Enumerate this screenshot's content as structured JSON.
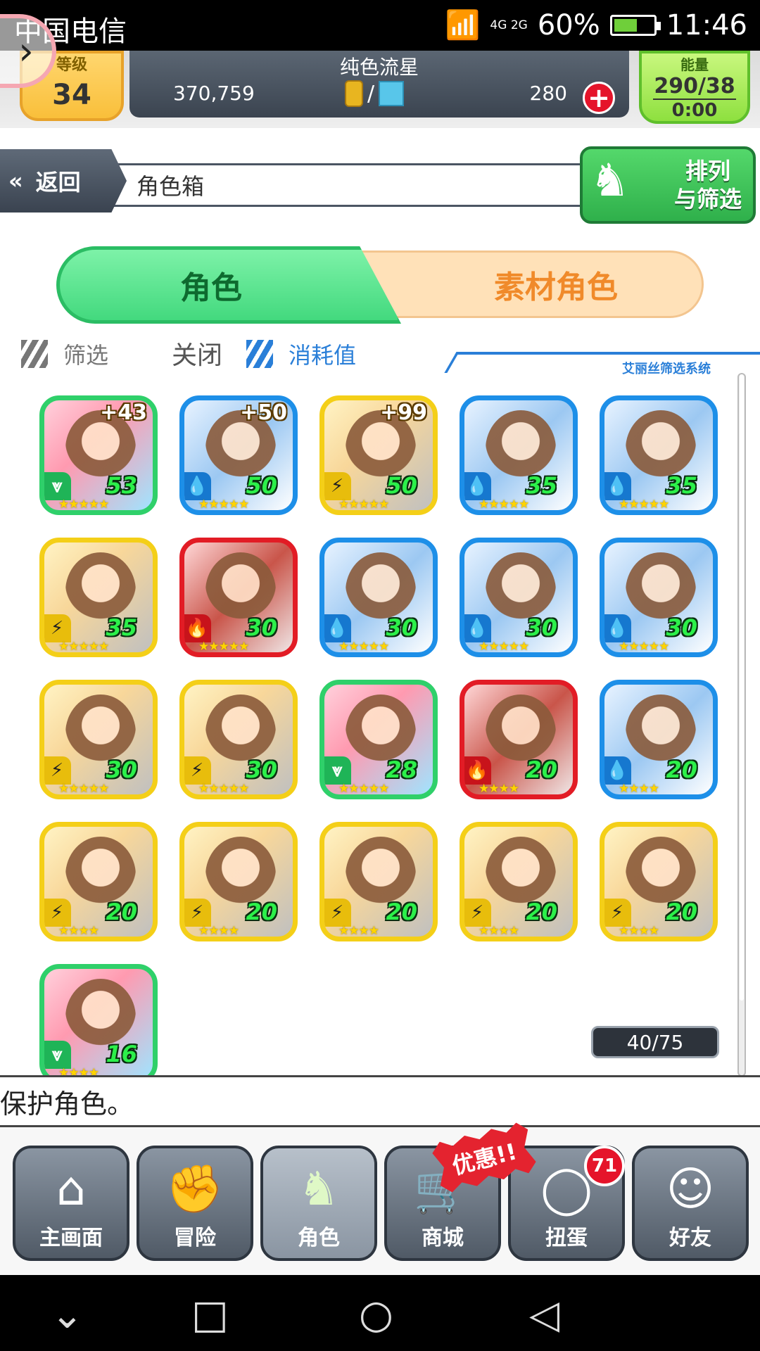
{
  "status_bar": {
    "carrier": "中国电信",
    "network": "4G 2G",
    "battery": "60%",
    "battery_level": 0.6,
    "time": "11:46"
  },
  "header": {
    "level_label": "等级",
    "level_value": "34",
    "player_name": "纯色流星",
    "coins": "370,759",
    "currency_sep": "/",
    "gems": "280",
    "stamina_label": "能量",
    "stamina": "290/38",
    "stamina_timer": "0:00"
  },
  "nav": {
    "back_label": "返回",
    "page_title": "角色箱",
    "sort_label_1": "排列",
    "sort_label_2": "与筛选"
  },
  "tabs": {
    "characters": "角色",
    "materials": "素材角色"
  },
  "filter": {
    "filter_label": "筛选",
    "filter_state": "关闭",
    "consumption_label": "消耗值",
    "system_label": "艾丽丝筛选系统"
  },
  "characters": [
    {
      "element": "wind",
      "level": "53",
      "plus": "+43",
      "stars": "★★★★★"
    },
    {
      "element": "water",
      "level": "50",
      "plus": "+50",
      "stars": "★★★★★"
    },
    {
      "element": "thunder",
      "level": "50",
      "plus": "+99",
      "stars": "★★★★★"
    },
    {
      "element": "water",
      "level": "35",
      "plus": "",
      "stars": "★★★★★"
    },
    {
      "element": "water",
      "level": "35",
      "plus": "",
      "stars": "★★★★★"
    },
    {
      "element": "thunder",
      "level": "35",
      "plus": "",
      "stars": "★★★★★"
    },
    {
      "element": "fire",
      "level": "30",
      "plus": "",
      "stars": "★★★★★"
    },
    {
      "element": "water",
      "level": "30",
      "plus": "",
      "stars": "★★★★★"
    },
    {
      "element": "water",
      "level": "30",
      "plus": "",
      "stars": "★★★★★"
    },
    {
      "element": "water",
      "level": "30",
      "plus": "",
      "stars": "★★★★★"
    },
    {
      "element": "thunder",
      "level": "30",
      "plus": "",
      "stars": "★★★★★"
    },
    {
      "element": "thunder",
      "level": "30",
      "plus": "",
      "stars": "★★★★★"
    },
    {
      "element": "wind",
      "level": "28",
      "plus": "",
      "stars": "★★★★★"
    },
    {
      "element": "fire",
      "level": "20",
      "plus": "",
      "stars": "★★★★"
    },
    {
      "element": "water",
      "level": "20",
      "plus": "",
      "stars": "★★★★"
    },
    {
      "element": "thunder",
      "level": "20",
      "plus": "",
      "stars": "★★★★"
    },
    {
      "element": "thunder",
      "level": "20",
      "plus": "",
      "stars": "★★★★"
    },
    {
      "element": "thunder",
      "level": "20",
      "plus": "",
      "stars": "★★★★"
    },
    {
      "element": "thunder",
      "level": "20",
      "plus": "",
      "stars": "★★★★"
    },
    {
      "element": "thunder",
      "level": "20",
      "plus": "",
      "stars": "★★★★"
    },
    {
      "element": "wind",
      "level": "16",
      "plus": "",
      "stars": "★★★★"
    }
  ],
  "box_count": "40/75",
  "message": "保护角色。",
  "bottom_nav": {
    "home": "主画面",
    "adventure": "冒险",
    "characters": "角色",
    "shop": "商城",
    "gacha": "扭蛋",
    "friends": "好友",
    "promo": "优惠!!",
    "gacha_badge": "71"
  },
  "colors": {
    "wind": "#2fd06a",
    "water": "#1d8fe8",
    "thunder": "#f4cf18",
    "fire": "#e21c25"
  }
}
